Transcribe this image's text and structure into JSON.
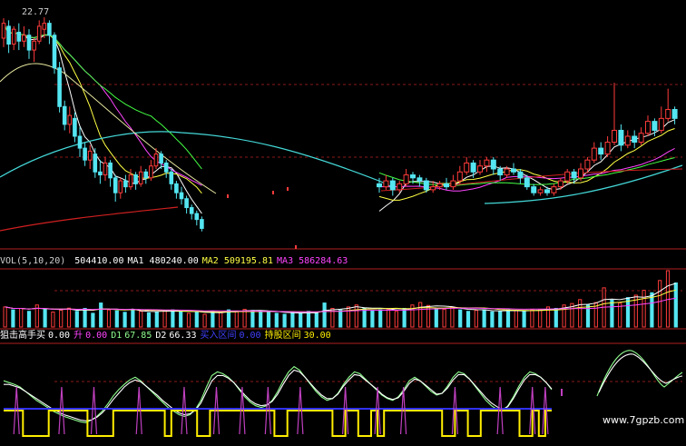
{
  "colors": {
    "up": "#ff3b3b",
    "down": "#54e6f2",
    "ma5": "#ffffff",
    "ma10": "#ffff44",
    "ma20": "#ff44ff",
    "ma30": "#44ff44",
    "ma60": "#44d7d7",
    "ma120": "#d02020",
    "grid": "#8b1a1a",
    "d1": "#8fff8f",
    "d2": "#ffffff",
    "hold": "#ffee00",
    "base": "#3030ff",
    "spike": "#c040c0"
  },
  "price_panel": {
    "top_label": "22.77",
    "cut_label": "一"
  },
  "volume_panel": {
    "title": "VOL(5,10,20)",
    "items": [
      {
        "name": "",
        "value": "504410.00",
        "color": "#ffffff"
      },
      {
        "name": "MA1",
        "value": "480240.00",
        "color": "#ffffff"
      },
      {
        "name": "MA2",
        "value": "509195.81",
        "color": "#ffff44"
      },
      {
        "name": "MA3",
        "value": "586284.63",
        "color": "#ff44ff"
      }
    ]
  },
  "indicator_panel": {
    "items": [
      {
        "name": "狙击高手买",
        "value": "0.00",
        "name_color": "#ffffff",
        "value_color": "#ffffff"
      },
      {
        "name": "升",
        "value": "0.00",
        "name_color": "#ff44ff",
        "value_color": "#ff44ff"
      },
      {
        "name": "D1",
        "value": "67.85",
        "name_color": "#8fff8f",
        "value_color": "#8fff8f"
      },
      {
        "name": "D2",
        "value": "66.33",
        "name_color": "#ffffff",
        "value_color": "#ffffff"
      },
      {
        "name": "买入区间",
        "value": "0.00",
        "name_color": "#4040ff",
        "value_color": "#4040ff"
      },
      {
        "name": "持股区间",
        "value": "30.00",
        "name_color": "#ffee00",
        "value_color": "#ffee00"
      }
    ]
  },
  "watermark": "www.7gpzb.com",
  "chart_data": {
    "type": "candlestick",
    "ylim_price": [
      15.5,
      23.2
    ],
    "candles": [
      [
        22.1,
        22.6,
        22.77,
        21.8
      ],
      [
        22.5,
        21.9,
        22.7,
        21.6
      ],
      [
        21.9,
        22.4,
        22.5,
        21.7
      ],
      [
        22.3,
        22.0,
        22.6,
        21.7
      ],
      [
        22.0,
        22.2,
        22.5,
        21.8
      ],
      [
        22.2,
        21.7,
        22.4,
        21.4
      ],
      [
        21.7,
        22.0,
        22.1,
        21.3
      ],
      [
        22.0,
        22.5,
        22.7,
        21.9
      ],
      [
        22.4,
        22.6,
        22.8,
        22.1
      ],
      [
        22.6,
        22.2,
        22.7,
        21.9
      ],
      [
        22.2,
        21.1,
        22.3,
        20.9
      ],
      [
        21.1,
        19.8,
        21.3,
        19.6
      ],
      [
        19.8,
        19.2,
        20.0,
        19.0
      ],
      [
        19.2,
        19.5,
        19.8,
        18.9
      ],
      [
        19.4,
        18.8,
        19.6,
        18.6
      ],
      [
        18.8,
        18.4,
        19.1,
        18.1
      ],
      [
        18.4,
        18.0,
        18.6,
        17.8
      ],
      [
        18.0,
        18.3,
        18.5,
        17.7
      ],
      [
        18.2,
        17.6,
        18.4,
        17.4
      ],
      [
        17.6,
        17.5,
        18.0,
        17.2
      ],
      [
        17.5,
        17.9,
        18.1,
        17.3
      ],
      [
        17.9,
        17.4,
        18.0,
        17.1
      ],
      [
        17.4,
        16.9,
        17.5,
        16.6
      ],
      [
        16.9,
        17.3,
        17.4,
        16.7
      ],
      [
        17.3,
        17.1,
        17.5,
        16.9
      ],
      [
        17.1,
        17.5,
        17.7,
        17.0
      ],
      [
        17.5,
        17.2,
        17.6,
        17.0
      ],
      [
        17.2,
        17.6,
        17.8,
        17.1
      ],
      [
        17.6,
        17.4,
        17.7,
        17.2
      ],
      [
        17.4,
        17.8,
        18.0,
        17.3
      ],
      [
        17.8,
        18.2,
        18.4,
        17.7
      ],
      [
        18.2,
        17.9,
        18.3,
        17.7
      ],
      [
        17.9,
        17.6,
        18.0,
        17.4
      ],
      [
        17.6,
        17.2,
        17.7,
        17.0
      ],
      [
        17.2,
        16.9,
        17.3,
        16.7
      ],
      [
        16.9,
        16.7,
        17.1,
        16.5
      ],
      [
        16.7,
        16.4,
        16.8,
        16.2
      ],
      [
        16.4,
        16.2,
        16.5,
        16.0
      ],
      [
        16.2,
        16.0,
        16.3,
        15.8
      ],
      [
        16.0,
        15.7,
        16.1,
        15.6
      ],
      [
        17.2,
        17.1,
        17.4,
        16.9
      ],
      [
        17.1,
        17.3,
        17.5,
        17.0
      ],
      [
        17.3,
        17.0,
        17.4,
        16.8
      ],
      [
        17.0,
        17.2,
        17.3,
        16.9
      ],
      [
        17.2,
        17.5,
        17.7,
        17.1
      ],
      [
        17.5,
        17.4,
        17.6,
        17.2
      ],
      [
        17.4,
        17.3,
        17.5,
        17.1
      ],
      [
        17.3,
        17.0,
        17.4,
        16.9
      ],
      [
        17.0,
        17.1,
        17.3,
        16.9
      ],
      [
        17.1,
        17.2,
        17.3,
        17.0
      ],
      [
        17.2,
        17.1,
        17.4,
        17.0
      ],
      [
        17.1,
        17.3,
        17.5,
        17.0
      ],
      [
        17.3,
        17.6,
        17.8,
        17.2
      ],
      [
        17.6,
        17.9,
        18.1,
        17.5
      ],
      [
        17.9,
        17.6,
        18.0,
        17.4
      ],
      [
        17.6,
        17.8,
        18.0,
        17.5
      ],
      [
        17.8,
        18.0,
        18.1,
        17.6
      ],
      [
        18.0,
        17.7,
        18.1,
        17.5
      ],
      [
        17.7,
        17.5,
        17.8,
        17.3
      ],
      [
        17.5,
        17.7,
        17.8,
        17.4
      ],
      [
        17.7,
        17.6,
        17.9,
        17.5
      ],
      [
        17.6,
        17.4,
        17.7,
        17.2
      ],
      [
        17.4,
        17.1,
        17.5,
        17.0
      ],
      [
        17.1,
        16.9,
        17.2,
        16.8
      ],
      [
        16.9,
        17.0,
        17.1,
        16.8
      ],
      [
        17.0,
        16.9,
        17.1,
        16.8
      ],
      [
        16.9,
        17.1,
        17.2,
        16.8
      ],
      [
        17.1,
        17.3,
        17.4,
        17.0
      ],
      [
        17.3,
        17.6,
        17.7,
        17.2
      ],
      [
        17.6,
        17.4,
        17.7,
        17.2
      ],
      [
        17.4,
        17.7,
        17.9,
        17.3
      ],
      [
        17.7,
        18.0,
        18.1,
        17.6
      ],
      [
        18.0,
        18.4,
        18.6,
        17.9
      ],
      [
        18.4,
        18.2,
        18.6,
        18.0
      ],
      [
        18.2,
        18.6,
        18.8,
        18.1
      ],
      [
        18.6,
        19.0,
        20.6,
        18.5
      ],
      [
        19.0,
        18.5,
        19.2,
        18.3
      ],
      [
        18.5,
        18.8,
        19.0,
        18.4
      ],
      [
        18.8,
        18.6,
        19.0,
        18.4
      ],
      [
        18.6,
        18.9,
        19.1,
        18.5
      ],
      [
        18.9,
        19.3,
        19.5,
        18.8
      ],
      [
        19.3,
        19.0,
        19.4,
        18.8
      ],
      [
        19.0,
        19.4,
        19.8,
        18.9
      ],
      [
        19.4,
        19.7,
        20.4,
        19.3
      ],
      [
        19.7,
        19.4,
        19.8,
        19.2
      ]
    ],
    "volume": [
      820,
      700,
      760,
      640,
      900,
      720,
      610,
      690,
      770,
      640,
      760,
      560,
      980,
      700,
      660,
      600,
      720,
      640,
      580,
      620,
      680,
      700,
      640,
      560,
      600,
      520,
      640,
      610,
      700,
      650,
      720,
      680,
      640,
      600,
      560,
      520,
      600,
      580,
      640,
      560,
      980,
      760,
      700,
      820,
      900,
      760,
      680,
      700,
      720,
      640,
      760,
      900,
      1000,
      880,
      760,
      720,
      800,
      700,
      640,
      680,
      700,
      620,
      640,
      700,
      680,
      640,
      700,
      720,
      820,
      760,
      900,
      960,
      1120,
      900,
      1000,
      1600,
      1100,
      980,
      1200,
      1300,
      1500,
      1400,
      1900,
      2300,
      1800
    ],
    "indicator_d1": [
      62,
      60,
      58,
      55,
      50,
      45,
      40,
      36,
      32,
      28,
      25,
      22,
      20,
      18,
      16,
      15,
      18,
      22,
      28,
      36,
      45,
      52,
      58,
      63,
      66,
      62,
      56,
      50,
      44,
      38,
      32,
      28,
      24,
      22,
      24,
      30,
      40,
      55,
      68,
      72,
      70,
      66,
      60,
      52,
      44,
      38,
      34,
      32,
      34,
      40,
      50,
      62,
      72,
      78,
      74,
      66,
      58,
      50,
      44,
      40,
      42,
      48,
      58,
      66,
      72,
      70,
      64,
      58,
      52,
      46,
      42,
      40,
      44,
      52,
      62,
      66,
      62,
      56,
      50,
      46,
      48,
      56,
      66,
      72,
      70,
      64,
      56,
      48,
      40,
      34,
      30,
      28,
      34,
      44,
      56,
      66,
      72,
      70,
      66,
      60,
      52
    ],
    "indicator_d2": [
      58,
      58,
      56,
      54,
      50,
      46,
      42,
      38,
      34,
      30,
      27,
      24,
      22,
      20,
      18,
      17,
      18,
      21,
      26,
      33,
      41,
      48,
      55,
      60,
      63,
      61,
      56,
      51,
      46,
      40,
      35,
      30,
      26,
      24,
      25,
      29,
      37,
      50,
      62,
      68,
      68,
      65,
      60,
      53,
      46,
      40,
      36,
      34,
      35,
      39,
      47,
      58,
      68,
      74,
      72,
      66,
      59,
      52,
      46,
      42,
      42,
      47,
      56,
      63,
      69,
      68,
      63,
      58,
      53,
      47,
      43,
      41,
      43,
      50,
      59,
      64,
      62,
      57,
      52,
      47,
      48,
      54,
      63,
      69,
      69,
      64,
      57,
      50,
      43,
      37,
      33,
      30,
      33,
      42,
      53,
      63,
      69,
      69,
      66,
      60,
      53
    ],
    "holding_zone": [
      1,
      1,
      1,
      0,
      0,
      0,
      0,
      1,
      1,
      1,
      1,
      1,
      1,
      0,
      0,
      0,
      0,
      1,
      1,
      1,
      1,
      1,
      1,
      1,
      1,
      0,
      1,
      1,
      1,
      1,
      0,
      0,
      1,
      1,
      1,
      1,
      1,
      1,
      1,
      1,
      1,
      1,
      0,
      0,
      1,
      1,
      1,
      1,
      1,
      1,
      1,
      0,
      0,
      1,
      1,
      0,
      0,
      1,
      0,
      1,
      1,
      1,
      1,
      1,
      1,
      1,
      1,
      1,
      0,
      0,
      1,
      1,
      0,
      0,
      1,
      1,
      1,
      1,
      1,
      1,
      0,
      0,
      1,
      0,
      1
    ],
    "buy_signals": [
      2,
      9,
      14,
      21,
      28,
      33,
      37,
      41,
      46,
      53,
      58,
      62,
      70,
      77,
      82,
      84
    ]
  }
}
